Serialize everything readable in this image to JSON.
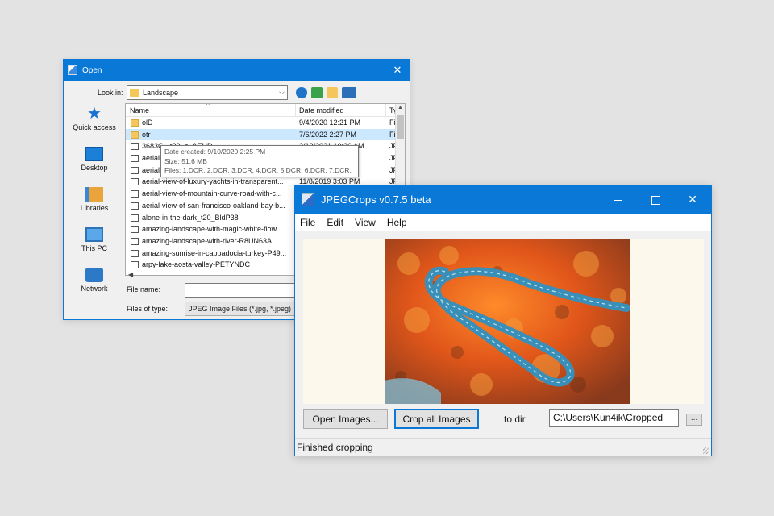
{
  "open_dialog": {
    "title": "Open",
    "close_glyph": "✕",
    "look_in_label": "Look in:",
    "look_in_value": "Landscape",
    "places": [
      {
        "label": "Quick access",
        "icon": "star-icon"
      },
      {
        "label": "Desktop",
        "icon": "desktop-icon"
      },
      {
        "label": "Libraries",
        "icon": "libraries-icon"
      },
      {
        "label": "This PC",
        "icon": "computer-icon"
      },
      {
        "label": "Network",
        "icon": "network-icon"
      }
    ],
    "columns": {
      "name": "Name",
      "modified": "Date modified",
      "type": "Ty"
    },
    "files": [
      {
        "name": "olD",
        "date": "9/4/2020 12:21 PM",
        "type": "Fil",
        "kind": "folder"
      },
      {
        "name": "otr",
        "date": "7/6/2022 2:27 PM",
        "type": "Fil",
        "kind": "folder"
      },
      {
        "name": "3683G...r20_b_AEHD",
        "date": "2/13/2021 10:36 AM",
        "type": "JPE",
        "kind": "image"
      },
      {
        "name": "aerial-",
        "date": "",
        "type": "JPE",
        "kind": "image"
      },
      {
        "name": "aerial-",
        "date": "",
        "type": "JPE",
        "kind": "image"
      },
      {
        "name": "aerial-view-of-luxury-yachts-in-transparent...",
        "date": "11/8/2019 3:03 PM",
        "type": "JPE",
        "kind": "image"
      },
      {
        "name": "aerial-view-of-mountain-curve-road-with-c...",
        "date": "",
        "type": "",
        "kind": "image"
      },
      {
        "name": "aerial-view-of-san-francisco-oakland-bay-b...",
        "date": "",
        "type": "",
        "kind": "image"
      },
      {
        "name": "alone-in-the-dark_t20_BldP38",
        "date": "",
        "type": "",
        "kind": "image"
      },
      {
        "name": "amazing-landscape-with-magic-white-flow...",
        "date": "",
        "type": "",
        "kind": "image"
      },
      {
        "name": "amazing-landscape-with-river-R8UN63A",
        "date": "",
        "type": "",
        "kind": "image"
      },
      {
        "name": "amazing-sunrise-in-cappadocia-turkey-P49...",
        "date": "",
        "type": "",
        "kind": "image"
      },
      {
        "name": "arpy-lake-aosta-valley-PETYNDC",
        "date": "",
        "type": "",
        "kind": "image"
      }
    ],
    "tooltip": {
      "line1": "Date created: 9/10/2020 2:25 PM",
      "line2": "Size: 51.6 MB",
      "line3": "Files: 1.DCR, 2.DCR, 3.DCR, 4.DCR, 5.DCR, 6.DCR, 7.DCR, ..."
    },
    "file_name_label": "File name:",
    "file_name_value": "",
    "file_type_label": "Files of type:",
    "file_type_value": "JPEG Image Files (*.jpg, *.jpeg)"
  },
  "jpegcrops": {
    "title": "JPEGCrops v0.7.5 beta",
    "menu": [
      "File",
      "Edit",
      "View",
      "Help"
    ],
    "open_button": "Open Images...",
    "crop_button": "Crop all Images",
    "to_dir_label": "to dir",
    "dir_value": "C:\\Users\\Kun4ik\\Cropped",
    "browse_button": "...",
    "close_glyph": "✕",
    "status": "Finished cropping",
    "accent_color": "#0a78d7"
  }
}
